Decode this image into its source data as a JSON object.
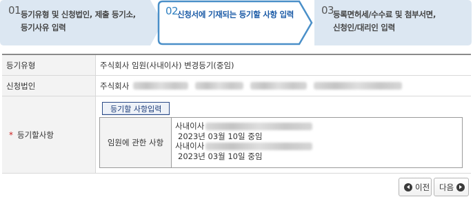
{
  "steps": [
    {
      "num": "01",
      "label_line1": "등기유형 및 신청법인, 제출 등기소,",
      "label_line2": "등기사유 입력"
    },
    {
      "num": "02",
      "label_line1": "신청서에 기재되는 등기할 사항 입력",
      "label_line2": ""
    },
    {
      "num": "03",
      "label_line1": "등록면허세/수수료 및 첨부서면,",
      "label_line2": "신청인/대리인 입력"
    }
  ],
  "form": {
    "registration_type_label": "등기유형",
    "registration_type_value": "주식회사 임원(사내이사) 변경등기(중임)",
    "applicant_label": "신청법인",
    "applicant_prefix": "주식회사",
    "items_label": "등기할사항",
    "required_mark": "*",
    "entry_button_label": "등기할 사항입력",
    "officer_header": "임원에 관한 사항",
    "officers": [
      {
        "title": "사내이사",
        "date": "2023년 03월 10일 중임"
      },
      {
        "title": "사내이사",
        "date": "2023년 03월 10일 중임"
      }
    ]
  },
  "nav": {
    "prev_label": "이전",
    "next_label": "다음"
  },
  "colors": {
    "step_fill": "#dce7f2",
    "step_active_border": "#4a8fc8",
    "step_active_num": "#2d7fc1",
    "required": "#cc2222"
  }
}
